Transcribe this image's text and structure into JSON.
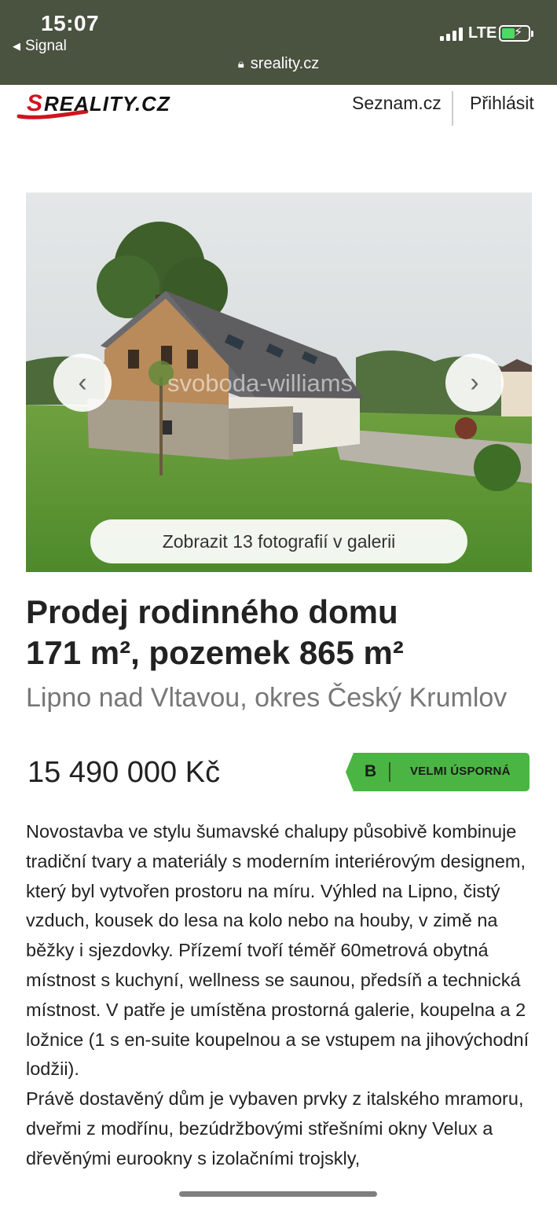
{
  "status_bar": {
    "time": "15:07",
    "back_app": "Signal",
    "network": "LTE",
    "url": "sreality.cz"
  },
  "header": {
    "logo_text": "SREALITY.CZ",
    "nav": [
      "Seznam.cz",
      "Přihlásit"
    ]
  },
  "gallery": {
    "watermark": "svoboda-williams",
    "button_label": "Zobrazit 13 fotografií v galerii",
    "prev_icon": "chevron-left-icon",
    "next_icon": "chevron-right-icon"
  },
  "listing": {
    "title_line1": "Prodej rodinného domu",
    "title_line2": "171 m², pozemek 865 m²",
    "locality": "Lipno nad Vltavou, okres Český Krumlov",
    "price": "15 490 000 Kč",
    "energy_class": "B",
    "energy_label": "VELMI ÚSPORNÁ",
    "energy_color": "#4bb543",
    "description_p1": "Novostavba ve stylu šumavské chalupy působivě kombinuje tradiční tvary a materiály s moderním interiérovým designem, který byl vytvořen prostoru na míru. Výhled na Lipno, čistý vzduch, kousek do lesa na kolo nebo na houby, v zimě na běžky i sjezdovky. Přízemí tvoří téměř 60metrová obytná místnost s kuchyní, wellness se saunou, předsíň a technická místnost. V patře je umístěna prostorná galerie, koupelna a 2 ložnice (1 s en-suite koupelnou a se vstupem na jihovýchodní lodžii).",
    "description_p2": "Právě dostavěný dům je vybaven prvky z italského mramoru, dveřmi z modřínu, bezúdržbovými střešními okny Velux a dřevěnými eurookny s izolačními trojskly,"
  }
}
